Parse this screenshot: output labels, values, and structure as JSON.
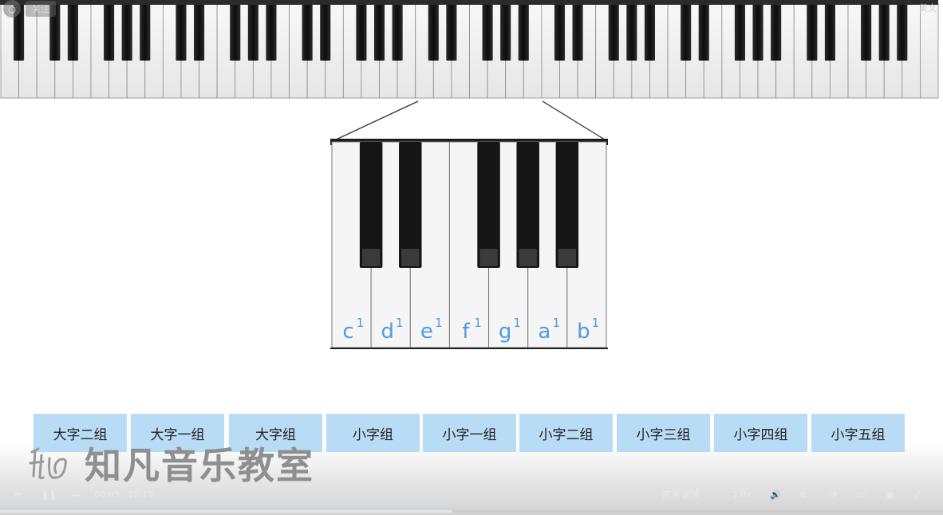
{
  "player": {
    "close_label": "关注",
    "top_right_label": "英文",
    "time_label": "00:03 / 10:19",
    "speed_label": "1.0x",
    "quality_label": "高清 超清",
    "progress": 0.48
  },
  "zoom_keys": {
    "letters": [
      "c",
      "d",
      "e",
      "f",
      "g",
      "a",
      "b"
    ],
    "octave_mark": "1",
    "label_color": "#4f9be6"
  },
  "groups": [
    "大字二组",
    "大字一组",
    "大字组",
    "小字组",
    "小字一组",
    "小字二组",
    "小字三组",
    "小字四组",
    "小字五组"
  ],
  "watermark": {
    "text": "知凡音乐教室"
  },
  "colors": {
    "tab_bg": "#b9dcf6",
    "white_key": "#f4f4f4",
    "black_key": "#111111"
  }
}
